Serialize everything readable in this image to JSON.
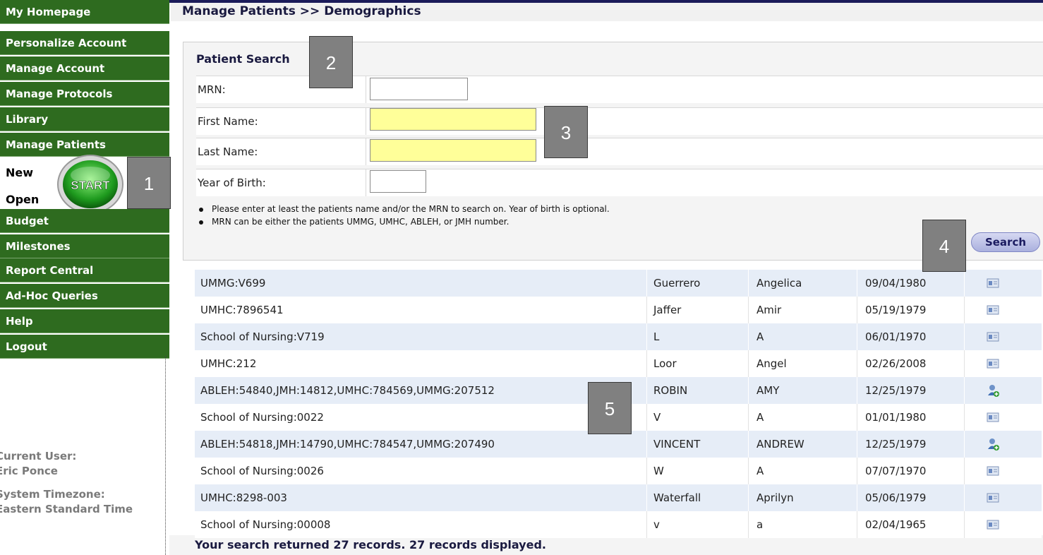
{
  "nav": [
    {
      "label": "My Homepage"
    },
    {
      "label": "Personalize Account"
    },
    {
      "label": "Manage Account"
    },
    {
      "label": "Manage Protocols"
    },
    {
      "label": "Library"
    },
    {
      "label": "Manage Patients"
    }
  ],
  "subnav": [
    {
      "label": "New"
    },
    {
      "label": "Open"
    }
  ],
  "start_label": "START",
  "nav2": [
    {
      "label": "Budget"
    },
    {
      "label": "Milestones"
    },
    {
      "label": "Report Central"
    },
    {
      "label": "Ad-Hoc Queries"
    },
    {
      "label": "Help"
    },
    {
      "label": "Logout"
    }
  ],
  "footer": {
    "user_label": "Current User:",
    "user_name": "Eric Ponce",
    "tz_label": "System Timezone:",
    "tz_value": "Eastern Standard Time"
  },
  "breadcrumb": "Manage Patients >> Demographics",
  "search": {
    "title": "Patient Search",
    "mrn_label": "MRN:",
    "first_label": "First Name:",
    "last_label": "Last Name:",
    "yob_label": "Year of Birth:",
    "mrn_value": "",
    "first_value": "",
    "last_value": "",
    "yob_value": "",
    "notes": [
      "Please enter at least the patients name and/or the MRN to search on. Year of birth is optional.",
      "MRN can be either the patients UMMG, UMHC, ABLEH, or JMH number."
    ],
    "button": "Search"
  },
  "callouts": [
    "1",
    "2",
    "3",
    "4",
    "5"
  ],
  "results": [
    {
      "mrn": "UMMG:V699",
      "last": "Guerrero",
      "first": "Angelica",
      "dob": "09/04/1980",
      "icon": "id-card-icon"
    },
    {
      "mrn": "UMHC:7896541",
      "last": "Jaffer",
      "first": "Amir",
      "dob": "05/19/1979",
      "icon": "id-card-icon"
    },
    {
      "mrn": "School of Nursing:V719",
      "last": "L",
      "first": "A",
      "dob": "06/01/1970",
      "icon": "id-card-icon"
    },
    {
      "mrn": "UMHC:212",
      "last": "Loor",
      "first": "Angel",
      "dob": "02/26/2008",
      "icon": "id-card-icon"
    },
    {
      "mrn": "ABLEH:54840,JMH:14812,UMHC:784569,UMMG:207512",
      "last": "ROBIN",
      "first": "AMY",
      "dob": "12/25/1979",
      "icon": "add-user-icon"
    },
    {
      "mrn": "School of Nursing:0022",
      "last": "V",
      "first": "A",
      "dob": "01/01/1980",
      "icon": "id-card-icon"
    },
    {
      "mrn": "ABLEH:54818,JMH:14790,UMHC:784547,UMMG:207490",
      "last": "VINCENT",
      "first": "ANDREW",
      "dob": "12/25/1979",
      "icon": "add-user-icon"
    },
    {
      "mrn": "School of Nursing:0026",
      "last": "W",
      "first": "A",
      "dob": "07/07/1970",
      "icon": "id-card-icon"
    },
    {
      "mrn": "UMHC:8298-003",
      "last": "Waterfall",
      "first": "Aprilyn",
      "dob": "05/06/1979",
      "icon": "id-card-icon"
    },
    {
      "mrn": "School of Nursing:00008",
      "last": "v",
      "first": "a",
      "dob": "02/04/1965",
      "icon": "id-card-icon"
    }
  ],
  "summary": "Your search returned 27 records. 27 records displayed."
}
